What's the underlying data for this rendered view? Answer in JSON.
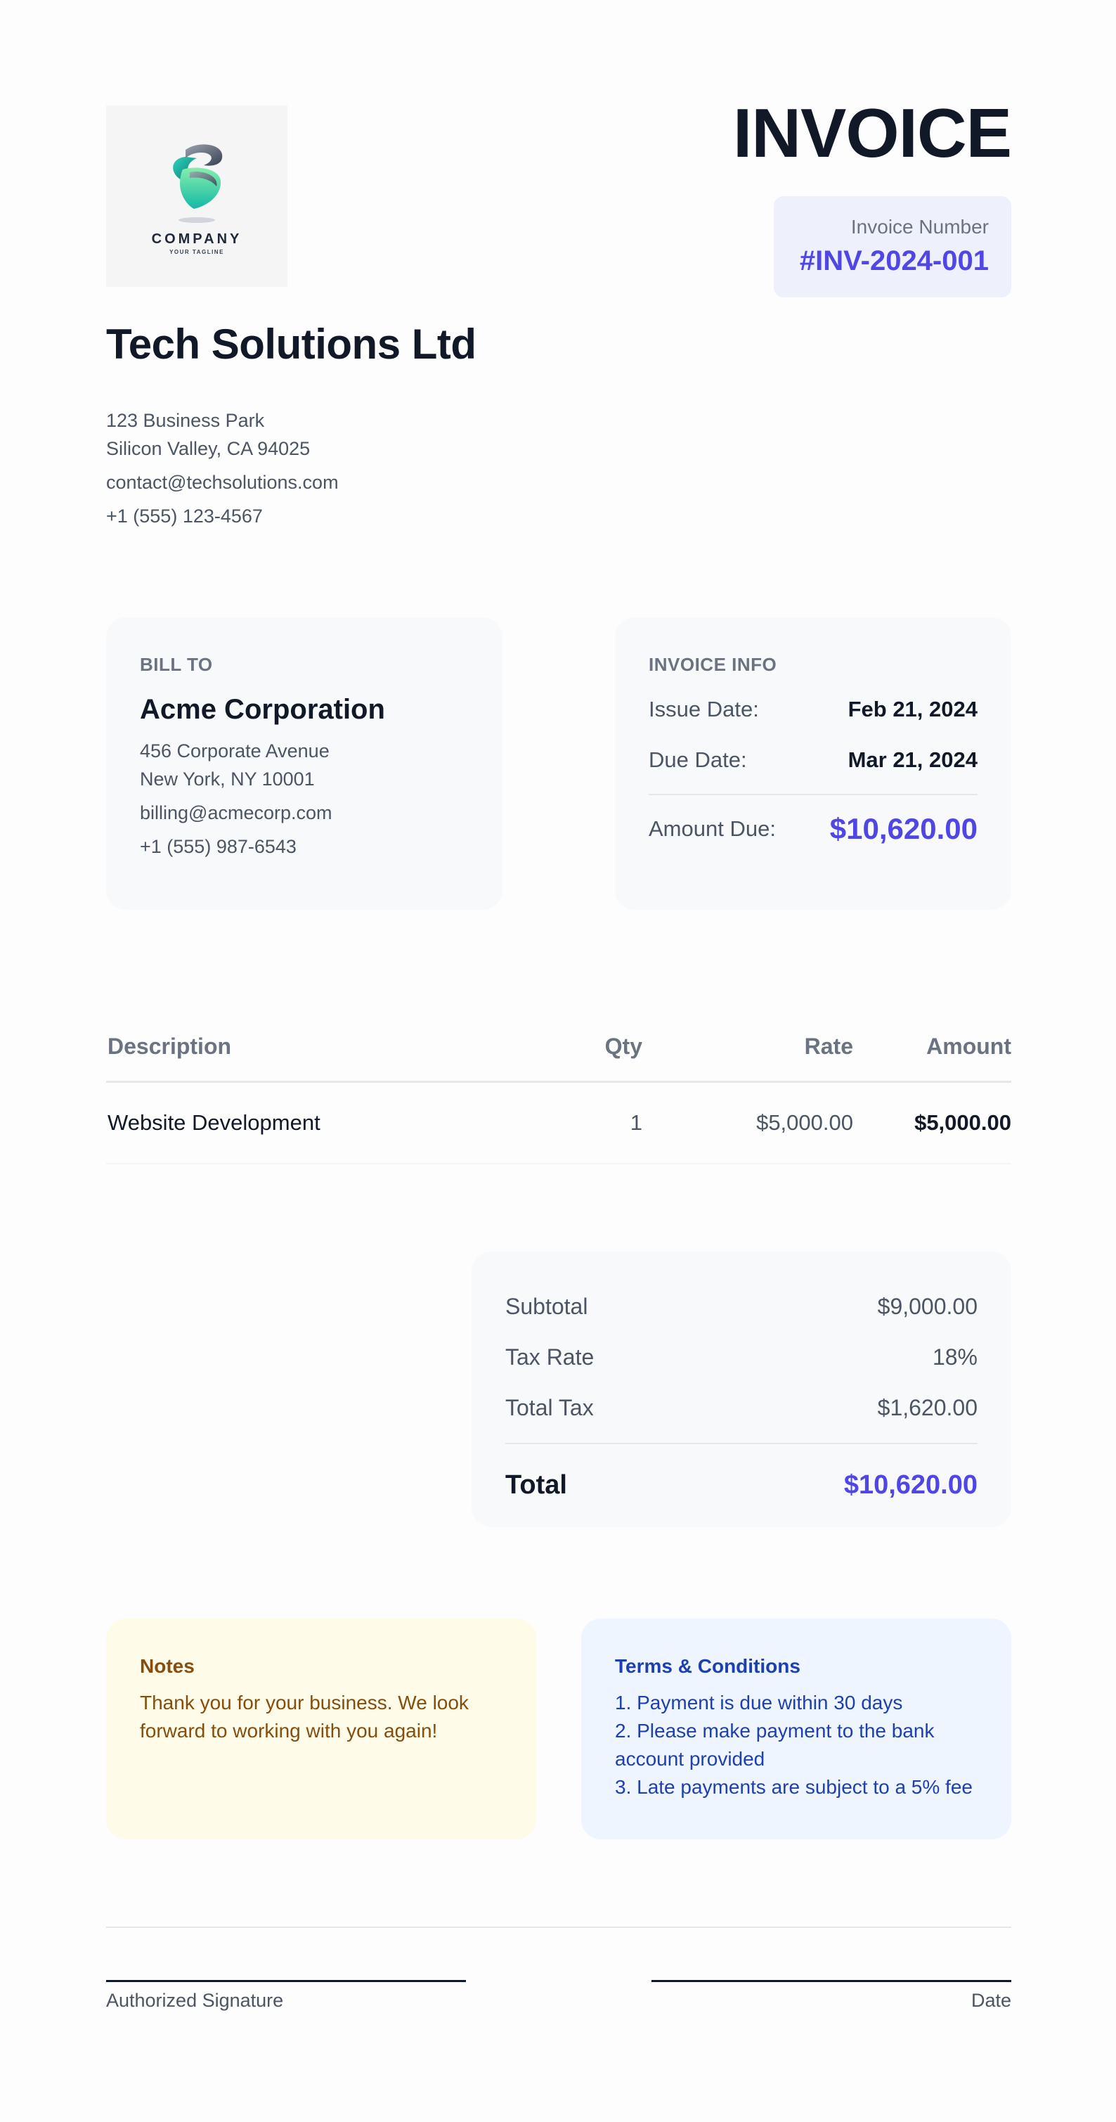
{
  "header": {
    "logo": {
      "wordmark": "COMPANY",
      "tagline": "YOUR TAGLINE"
    },
    "title": "INVOICE",
    "invoice_number_label": "Invoice Number",
    "invoice_number": "#INV-2024-001"
  },
  "company": {
    "name": "Tech Solutions Ltd",
    "address_line1": "123 Business Park",
    "address_line2": "Silicon Valley, CA 94025",
    "email": "contact@techsolutions.com",
    "phone": "+1 (555) 123-4567"
  },
  "bill_to": {
    "label": "BILL TO",
    "name": "Acme Corporation",
    "address_line1": "456 Corporate Avenue",
    "address_line2": "New York, NY 10001",
    "email": "billing@acmecorp.com",
    "phone": "+1 (555) 987-6543"
  },
  "invoice_info": {
    "label": "INVOICE INFO",
    "issue_date_label": "Issue Date:",
    "issue_date": "Feb 21, 2024",
    "due_date_label": "Due Date:",
    "due_date": "Mar 21, 2024",
    "amount_due_label": "Amount Due:",
    "amount_due": "$10,620.00"
  },
  "items": {
    "headers": {
      "description": "Description",
      "qty": "Qty",
      "rate": "Rate",
      "amount": "Amount"
    },
    "rows": [
      {
        "description": "Website Development",
        "qty": "1",
        "rate": "$5,000.00",
        "amount": "$5,000.00"
      }
    ]
  },
  "totals": {
    "subtotal_label": "Subtotal",
    "subtotal": "$9,000.00",
    "tax_rate_label": "Tax Rate",
    "tax_rate": "18%",
    "total_tax_label": "Total Tax",
    "total_tax": "$1,620.00",
    "total_label": "Total",
    "total": "$10,620.00"
  },
  "notes": {
    "title": "Notes",
    "body": "Thank you for your business. We look forward to working with you again!"
  },
  "terms": {
    "title": "Terms & Conditions",
    "lines": [
      "1. Payment is due within 30 days",
      "2. Please make payment to the bank account provided",
      "3. Late payments are subject to a 5% fee"
    ]
  },
  "footer": {
    "signature_label": "Authorized Signature",
    "date_label": "Date"
  },
  "colors": {
    "accent": "#4f46e5",
    "notes_bg": "#fefce8",
    "notes_text": "#854d0e",
    "terms_bg": "#eff5fe",
    "terms_text": "#1e40af"
  }
}
